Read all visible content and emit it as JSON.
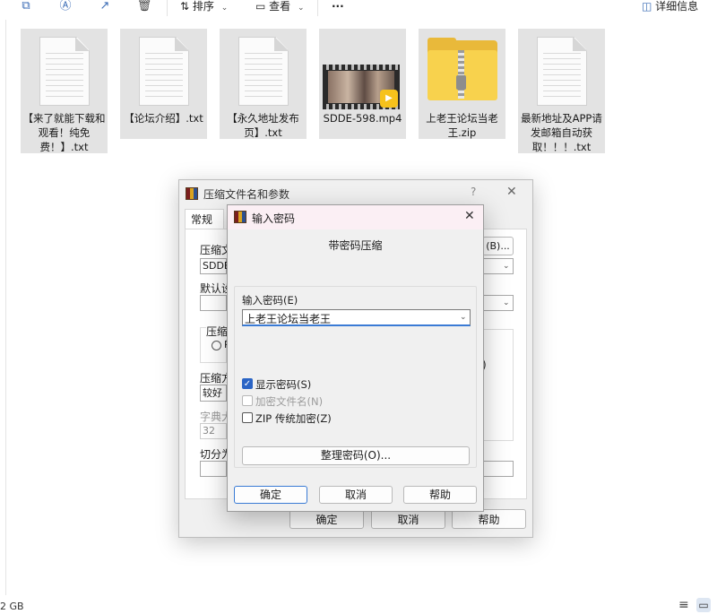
{
  "toolbar": {
    "sort_label": "排序",
    "view_label": "查看",
    "more_label": "···",
    "details_label": "详细信息"
  },
  "files": [
    {
      "name": "【来了就能下载和观看！纯免费！】.txt",
      "type": "text-file-icon"
    },
    {
      "name": "【论坛介绍】.txt",
      "type": "text-file-icon"
    },
    {
      "name": "【永久地址发布页】.txt",
      "type": "text-file-icon"
    },
    {
      "name": "SDDE-598.mp4",
      "type": "video-file-icon"
    },
    {
      "name": "上老王论坛当老王.zip",
      "type": "zip-folder-icon"
    },
    {
      "name": "最新地址及APP请发邮箱自动获取！！！.txt",
      "type": "text-file-icon"
    }
  ],
  "archive_dialog": {
    "title": "压缩文件名和参数",
    "help_glyph": "?",
    "close_glyph": "✕",
    "tab_general": "常规",
    "archive_name_label": "压缩文",
    "archive_name_value": "SDDE-",
    "browse_button": "(B)...",
    "default_profile_label": "默认设",
    "archive_format_label": "压缩",
    "radio_letter": "R",
    "method_label": "压缩方",
    "method_value": "较好",
    "dict_label": "字典大",
    "dict_value": "32",
    "right_fragment": ")",
    "split_label": "切分为",
    "ok_button": "确定",
    "cancel_button": "取消",
    "help_button": "帮助"
  },
  "password_dialog": {
    "title": "输入密码",
    "close_glyph": "✕",
    "subtitle": "带密码压缩",
    "password_label": "输入密码(E)",
    "password_value": "上老王论坛当老王",
    "show_password": {
      "label": "显示密码(S)",
      "checked": true,
      "enabled": true
    },
    "encrypt_names": {
      "label": "加密文件名(N)",
      "checked": false,
      "enabled": false
    },
    "zip_legacy": {
      "label": "ZIP 传统加密(Z)",
      "checked": false,
      "enabled": true
    },
    "organize_button": "整理密码(O)...",
    "ok_button": "确定",
    "cancel_button": "取消",
    "help_button": "帮助"
  },
  "statusbar": {
    "free_space": "2 GB"
  }
}
